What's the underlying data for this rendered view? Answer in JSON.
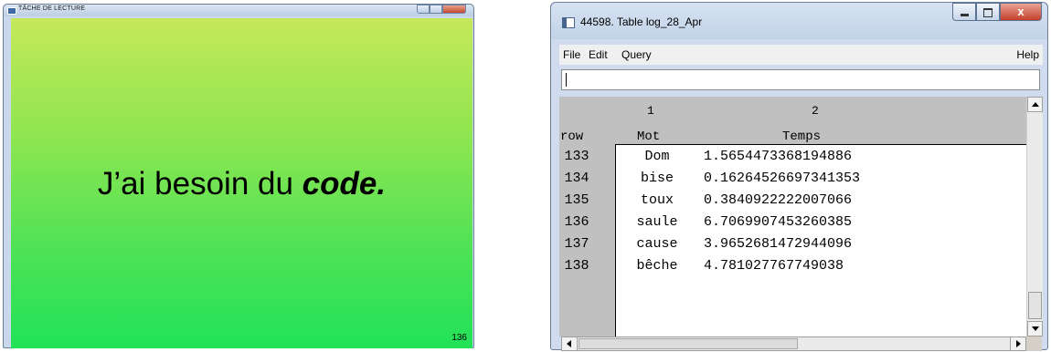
{
  "reading_window": {
    "title": "TÂCHE DE LECTURE",
    "phrase": "J’ai besoin du ",
    "word": "code.",
    "counter": "136"
  },
  "table_window": {
    "title": "44598. Table log_28_Apr",
    "close_symbol": "x",
    "menu": {
      "file": "File",
      "edit": "Edit",
      "query": "Query",
      "help": "Help"
    },
    "command_value": "",
    "grid": {
      "col_index": [
        "1",
        "2"
      ],
      "row_header": "row",
      "col_names": [
        "Mot",
        "Temps"
      ],
      "rows": [
        {
          "row": "133",
          "mot": "Dom",
          "temps": "1.5654473368194886"
        },
        {
          "row": "134",
          "mot": "bise",
          "temps": "0.16264526697341353"
        },
        {
          "row": "135",
          "mot": "toux",
          "temps": "0.3840922222007066"
        },
        {
          "row": "136",
          "mot": "saule",
          "temps": "6.7069907453260385"
        },
        {
          "row": "137",
          "mot": "cause",
          "temps": "3.9652681472944096"
        },
        {
          "row": "138",
          "mot": "bêche",
          "temps": "4.781027767749038"
        }
      ]
    }
  }
}
